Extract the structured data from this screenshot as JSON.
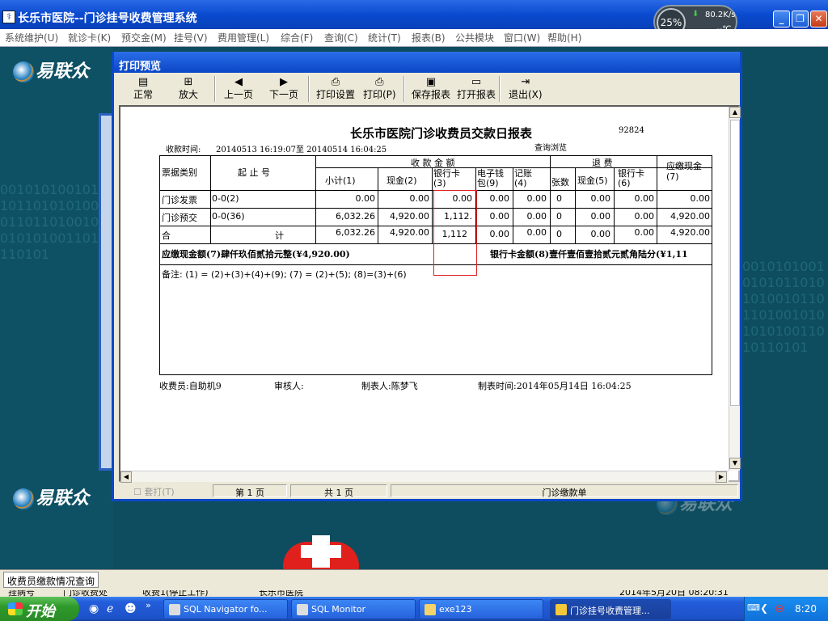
{
  "window": {
    "title": "长乐市医院--门诊挂号收费管理系统",
    "icon_name": "hospital-app-icon",
    "min": "_",
    "max": "❐",
    "close": "✕"
  },
  "net_widget": {
    "cpu": "25%",
    "speed": "80.2K/s",
    "temp": "--℃"
  },
  "menu": [
    "系统维护(U)",
    "就诊卡(K)",
    "预交金(M)",
    "挂号(V)",
    "费用管理(L)",
    "综合(F)",
    "查询(C)",
    "统计(T)",
    "报表(B)",
    "公共模块",
    "窗口(W)",
    "帮助(H)"
  ],
  "logo_text": "易联众",
  "bg_digits": "0010101001010101101010100101101101001010101010011010110101",
  "dialog": {
    "title": "打印预览",
    "toolbar": [
      "正常",
      "放大",
      "上一页",
      "下一页",
      "打印设置",
      "打印(P)",
      "保存报表",
      "打开报表",
      "退出(X)"
    ]
  },
  "report": {
    "title": "长乐市医院门诊收费员交款日报表",
    "code": "92824",
    "time_label": "收款时间:",
    "time_range": "20140513 16:19:07至 20140514 16:04:25",
    "query_label": "查询浏览",
    "headers": {
      "type": "票据类别",
      "range": "起 止 号",
      "receipt_group": "收 款 金 额",
      "refund_group": "退 费",
      "subtotal": "小计(1)",
      "cash": "现金(2)",
      "bankcard": "银行卡(3)",
      "ewallet": "电子钱包(9)",
      "credit": "记账(4)",
      "count": "张数",
      "refund_cash": "现金(5)",
      "refund_bank": "银行卡(6)",
      "due": "应缴现金(7)"
    },
    "rows": [
      {
        "type": "门诊发票",
        "range": "0-0(2)",
        "subtotal": "0.00",
        "cash": "0.00",
        "bankcard": "0.00",
        "ewallet": "0.00",
        "credit": "0.00",
        "count": "0",
        "refund_cash": "0.00",
        "refund_bank": "0.00",
        "due": "0.00"
      },
      {
        "type": "门诊预交",
        "range": "0-0(36)",
        "subtotal": "6,032.26",
        "cash": "4,920.00",
        "bankcard": "1,112.",
        "ewallet": "0.00",
        "credit": "0.00",
        "count": "0",
        "refund_cash": "0.00",
        "refund_bank": "0.00",
        "due": "4,920.00"
      },
      {
        "type": "合",
        "range": "计",
        "subtotal": "6,032.26",
        "cash": "4,920.00",
        "bankcard": "1,112",
        "ewallet": "0.00",
        "credit": "0.00",
        "count": "0",
        "refund_cash": "0.00",
        "refund_bank": "0.00",
        "due": "4,920.00"
      }
    ],
    "due_cash_words": "应缴现金额(7)肆仟玖佰贰拾元整(¥4,920.00)",
    "bank_words": "银行卡金额(8)壹仟壹佰壹拾贰元贰角陆分(¥1,11",
    "note": "备注: (1) = (2)+(3)+(4)+(9); (7) = (2)+(5); (8)=(3)+(6)",
    "cashier": "收费员:自助机9",
    "reviewer": "审核人:",
    "maker": "制表人:陈梦飞",
    "made_time": "制表时间:2014年05月14日 16:04:25"
  },
  "status": {
    "checkbox": "套打(T)",
    "page": "第 1 页",
    "total": "共 1 页",
    "form": "门诊缴款单"
  },
  "infobar": {
    "tab": "收费员缴款情况查询",
    "row2": [
      "挂病号",
      "门诊收费处",
      "收费1(停止工作)",
      "长乐市医院",
      "2014年5月20日 08:20:31"
    ]
  },
  "taskbar": {
    "start": "开始",
    "tasks": [
      "SQL Navigator fo...",
      "SQL Monitor",
      "exe123",
      "门诊挂号收费管理..."
    ],
    "clock": "8:20"
  }
}
